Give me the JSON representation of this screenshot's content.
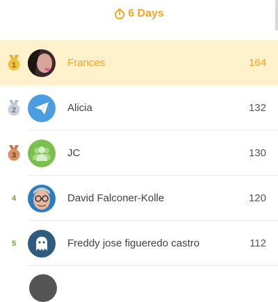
{
  "header": {
    "timer_icon": "stopwatch-icon",
    "duration": "6 Days",
    "accent": "#f5a623"
  },
  "leaderboard": [
    {
      "rank": "1",
      "rank_badge": "gold-medal-icon",
      "name": "Frances",
      "score": "164",
      "avatar": "profile-photo",
      "highlighted": true
    },
    {
      "rank": "2",
      "rank_badge": "silver-medal-icon",
      "name": "Alicia",
      "score": "132",
      "avatar": "paper-plane-icon"
    },
    {
      "rank": "3",
      "rank_badge": "bronze-medal-icon",
      "name": "JC",
      "score": "130",
      "avatar": "group-icon"
    },
    {
      "rank": "4",
      "name": "David Falconer-Kolle",
      "score": "120",
      "avatar": "profile-photo"
    },
    {
      "rank": "5",
      "name": "Freddy jose figueredo castro",
      "score": "112",
      "avatar": "ghost-icon"
    }
  ]
}
